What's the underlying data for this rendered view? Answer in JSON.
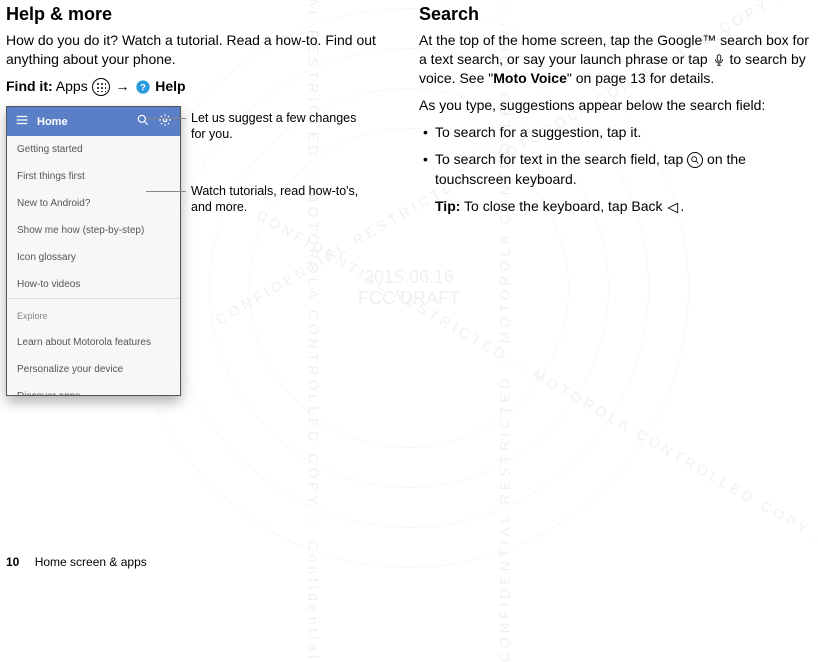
{
  "leftCol": {
    "heading": "Help & more",
    "intro": "How do you do it? Watch a tutorial. Read a how-to. Find out anything about your phone.",
    "findit_label": "Find it:",
    "findit_apps": "Apps",
    "findit_arrow": "→",
    "findit_help": "Help"
  },
  "phone": {
    "title": "Home",
    "items": [
      "Getting started",
      "First things first",
      "New to Android?",
      "Show me how (step-by-step)",
      "Icon glossary",
      "How-to videos"
    ],
    "sectionLabel": "Explore",
    "exploreItems": [
      "Learn about Motorola features",
      "Personalize your device",
      "Discover apps"
    ]
  },
  "callouts": {
    "c1": "Let us suggest a few changes for you.",
    "c2": "Watch tutorials, read how-to's, and more."
  },
  "rightCol": {
    "heading": "Search",
    "p1a": "At the top of the home screen, tap the Google™ search box for a text search, or say your launch phrase or tap ",
    "p1b": " to search by voice. See \"",
    "p1_bold": "Moto Voice",
    "p1c": "\" on page 13 for details.",
    "p2": "As you type, suggestions appear below the search field:",
    "b1": "To search for a suggestion, tap it.",
    "b2a": "To search for text in the search field, tap ",
    "b2b": " on the touchscreen keyboard.",
    "tip_label": "Tip:",
    "tip_a": " To close the keyboard, tap Back ",
    "tip_b": "."
  },
  "watermark": {
    "center1": "2015.06.16",
    "center2": "FCC DRAFT",
    "arc": "CONFIDENTIAL RESTRICTED :: MOTOROLA CONTROLLED COPY :: Confidential"
  },
  "footer": {
    "page": "10",
    "section": "Home screen & apps"
  }
}
